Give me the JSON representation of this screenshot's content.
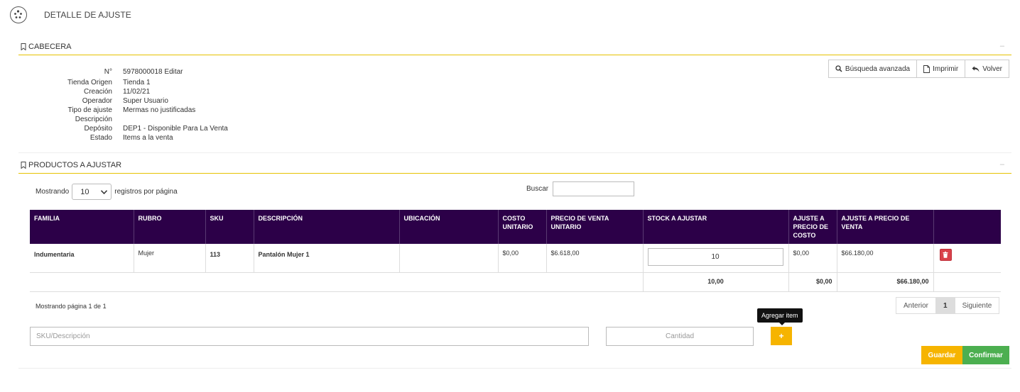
{
  "header": {
    "title": "DETALLE DE AJUSTE",
    "logo_icon": "app-logo-icon"
  },
  "cabecera": {
    "section_title": "CABECERA",
    "collapse_symbol": "–",
    "fields": [
      {
        "label": "N°",
        "value": "5978000018 Editar"
      },
      {
        "label": "Tienda Origen",
        "value": "Tienda 1"
      },
      {
        "label": "Creación",
        "value": "11/02/21"
      },
      {
        "label": "Operador",
        "value": "Super Usuario"
      },
      {
        "label": "Tipo de ajuste",
        "value": "Mermas no justificadas"
      },
      {
        "label": "Descripción",
        "value": ""
      },
      {
        "label": "Depósito",
        "value": "DEP1 - Disponible Para La Venta"
      },
      {
        "label": "Estado",
        "value": "Items a la venta"
      }
    ]
  },
  "actions": {
    "search": "Búsqueda avanzada",
    "print": "Imprimir",
    "back": "Volver"
  },
  "productos": {
    "section_title": "PRODUCTOS A AJUSTAR",
    "collapse_symbol": "–",
    "length_prefix": "Mostrando",
    "length_value": "10",
    "length_suffix": "registros por página",
    "search_label": "Buscar",
    "columns": [
      "FAMILIA",
      "RUBRO",
      "SKU",
      "DESCRIPCIÓN",
      "UBICACIÓN",
      "COSTO UNITARIO",
      "PRECIO DE VENTA UNITARIO",
      "STOCK A AJUSTAR",
      "AJUSTE A PRECIO DE COSTO",
      "AJUSTE A PRECIO DE VENTA",
      ""
    ],
    "rows": [
      {
        "familia": "Indumentaria",
        "rubro": "Mujer",
        "sku": "113",
        "descripcion": "Pantalón Mujer 1",
        "ubicacion": "",
        "costo": "$0,00",
        "precio": "$6.618,00",
        "stock": "10",
        "ajuste_costo": "$0,00",
        "ajuste_venta": "$66.180,00"
      }
    ],
    "totals": {
      "stock": "10,00",
      "costo": "$0,00",
      "venta": "$66.180,00"
    },
    "paging_info": "Mostrando página 1 de 1",
    "pager": {
      "prev": "Anterior",
      "current": "1",
      "next": "Siguiente"
    }
  },
  "add_item": {
    "sku_placeholder": "SKU/Descripción",
    "qty_placeholder": "Cantidad",
    "add_symbol": "+",
    "tooltip": "Agregar item"
  },
  "footer": {
    "save": "Guardar",
    "confirm": "Confirmar"
  },
  "colors": {
    "header_bg": "#2c0048",
    "accent_line": "#e6c200",
    "warning": "#f6b400",
    "success": "#4caf50",
    "danger": "#d9414a"
  }
}
